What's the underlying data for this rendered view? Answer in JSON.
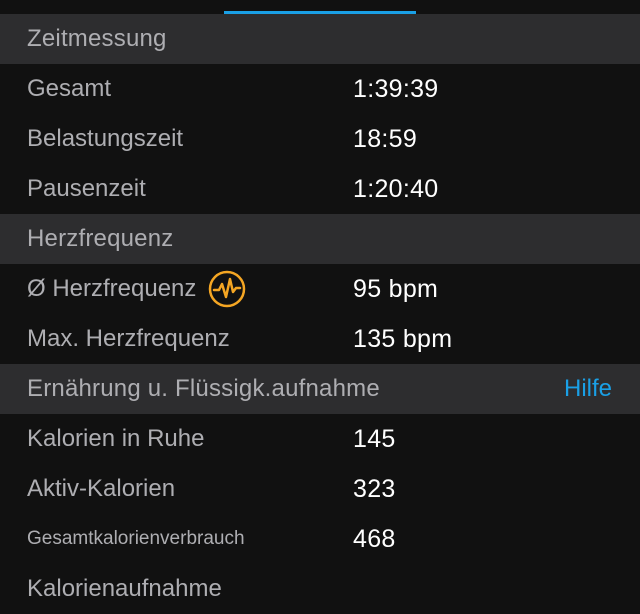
{
  "sections": [
    {
      "title": "Zeitmessung",
      "rows": [
        {
          "label": "Gesamt",
          "value": "1:39:39"
        },
        {
          "label": "Belastungszeit",
          "value": "18:59"
        },
        {
          "label": "Pausenzeit",
          "value": "1:20:40"
        }
      ]
    },
    {
      "title": "Herzfrequenz",
      "rows": [
        {
          "label": "Ø Herzfrequenz",
          "value": "95 bpm",
          "icon": "heart-rate-icon"
        },
        {
          "label": "Max. Herzfrequenz",
          "value": "135 bpm"
        }
      ]
    },
    {
      "title": "Ernährung u. Flüssigk.aufnahme",
      "action": "Hilfe",
      "rows": [
        {
          "label": "Kalorien in Ruhe",
          "value": "145"
        },
        {
          "label": "Aktiv-Kalorien",
          "value": "323"
        },
        {
          "label": "Gesamtkalorienverbrauch",
          "value": "468"
        },
        {
          "label": "Kalorienaufnahme",
          "value": ""
        }
      ]
    }
  ],
  "colors": {
    "accent": "#1aa0e6",
    "heart_icon": "#f5a623",
    "header_bg": "#2d2d2f",
    "row_bg": "#111111"
  }
}
